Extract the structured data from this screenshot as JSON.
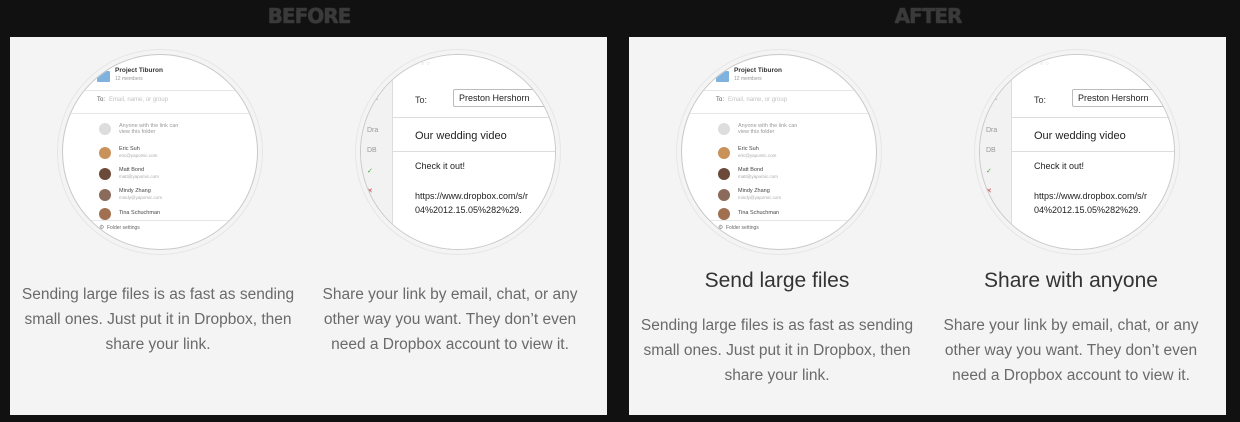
{
  "before": {
    "heading": "BEFORE",
    "col1": {
      "desc": "Sending large files is as fast as sending small ones. Just put it in Dropbox, then share your link."
    },
    "col2": {
      "desc": "Share your link by email, chat, or any other way you want. They don’t even need a Dropbox account to view it."
    }
  },
  "after": {
    "heading": "AFTER",
    "col1": {
      "title": "Send large files",
      "desc": "Sending large files is as fast as sending small ones. Just put it in Dropbox, then share your link."
    },
    "col2": {
      "title": "Share with anyone",
      "desc": "Share your link by email, chat, or any other way you want. They don’t even need a Dropbox account to view it."
    }
  },
  "share_dialog": {
    "folder_name": "Project Tiburon",
    "members": "12 members",
    "to_label": "To:",
    "to_placeholder": "Email, name, or group",
    "anyone_line1": "Anyone with the link can",
    "anyone_line2": "view this folder",
    "people": [
      {
        "name": "Eric Suh",
        "email": "eric@yapomic.com"
      },
      {
        "name": "Matt Bond",
        "email": "matt@yapomic.com"
      },
      {
        "name": "Mindy Zhang",
        "email": "mindy@yapomic.com"
      },
      {
        "name": "Tina Schuchman",
        "email": ""
      }
    ],
    "footer": "Folder settings"
  },
  "compose": {
    "sidebar": [
      "List",
      "Dra",
      "DB",
      "Arch",
      "Tras"
    ],
    "to_label": "To:",
    "to_value": "Preston Hershorn",
    "subject": "Our wedding video",
    "body_line1": "Check it out!",
    "link_line1": "https://www.dropbox.com/s/r",
    "link_line2": "04%2012.15.05%282%29."
  }
}
